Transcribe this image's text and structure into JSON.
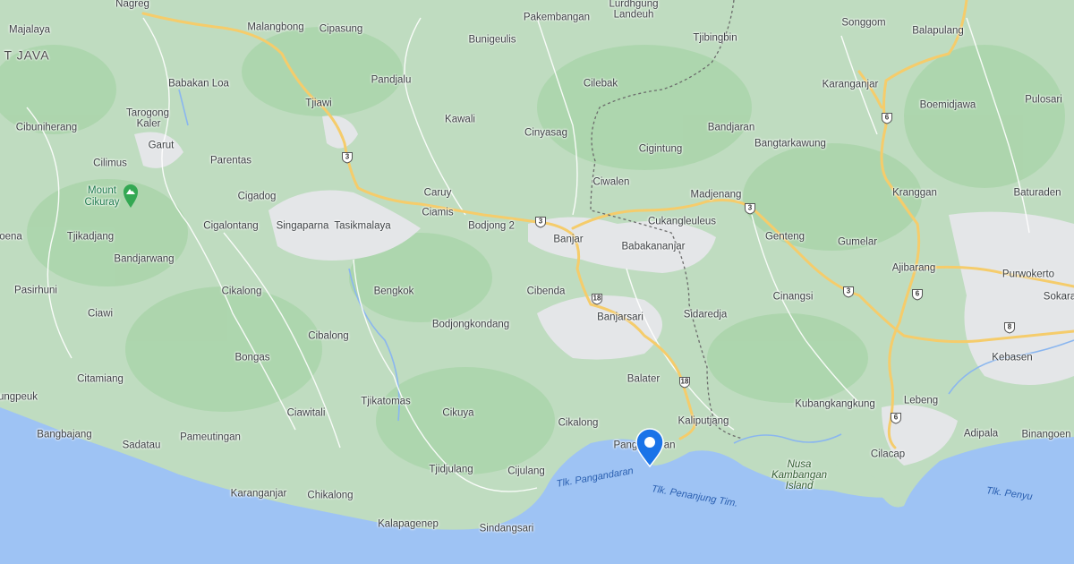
{
  "map": {
    "colors": {
      "land": "#bfdcc0",
      "forest": "#a8d5aa",
      "urban": "#e8eaed",
      "sea": "#9ec4f5",
      "road_major": "#f7d27b",
      "road_minor": "#ffffff",
      "border": "#6b6b6b"
    },
    "region_label": "T JAVA",
    "places": [
      {
        "id": "nagreg",
        "name": "Nagreg"
      },
      {
        "id": "majalaya",
        "name": "Majalaya"
      },
      {
        "id": "malangbong",
        "name": "Malangbong"
      },
      {
        "id": "cipasung",
        "name": "Cipasung"
      },
      {
        "id": "bunigeulis",
        "name": "Bunigeulis"
      },
      {
        "id": "pakembangan",
        "name": "Pakembangan"
      },
      {
        "id": "lurdhgung",
        "name": "Lurdhgung"
      },
      {
        "id": "landeuh",
        "name": "Landeuh"
      },
      {
        "id": "tjibingbin",
        "name": "Tjibingbin"
      },
      {
        "id": "songgom",
        "name": "Songgom"
      },
      {
        "id": "balapulang",
        "name": "Balapulang"
      },
      {
        "id": "babakan-loa",
        "name": "Babakan Loa"
      },
      {
        "id": "pandjalu",
        "name": "Pandjalu"
      },
      {
        "id": "cilebak",
        "name": "Cilebak"
      },
      {
        "id": "karanganjar-n",
        "name": "Karanganjar"
      },
      {
        "id": "boemidjawa",
        "name": "Boemidjawa"
      },
      {
        "id": "pulosari",
        "name": "Pulosari"
      },
      {
        "id": "tarogong",
        "name": "Tarogong"
      },
      {
        "id": "kaler",
        "name": "Kaler"
      },
      {
        "id": "tjiawi",
        "name": "Tjiawi"
      },
      {
        "id": "kawali",
        "name": "Kawali"
      },
      {
        "id": "cibuniherang",
        "name": "Cibuniherang"
      },
      {
        "id": "cinyasag",
        "name": "Cinyasag"
      },
      {
        "id": "bandjaran",
        "name": "Bandjaran"
      },
      {
        "id": "garut",
        "name": "Garut"
      },
      {
        "id": "bangtarkawung",
        "name": "Bangtarkawung"
      },
      {
        "id": "cigintung",
        "name": "Cigintung"
      },
      {
        "id": "parentas",
        "name": "Parentas"
      },
      {
        "id": "cilimus",
        "name": "Cilimus"
      },
      {
        "id": "ciwalen",
        "name": "Ciwalen"
      },
      {
        "id": "cigadog",
        "name": "Cigadog"
      },
      {
        "id": "caruy",
        "name": "Caruy"
      },
      {
        "id": "madjenang",
        "name": "Madjenang"
      },
      {
        "id": "kranggan",
        "name": "Kranggan"
      },
      {
        "id": "baturaden",
        "name": "Baturaden"
      },
      {
        "id": "ciamis",
        "name": "Ciamis"
      },
      {
        "id": "cukangleuleus",
        "name": "Cukangleuleus"
      },
      {
        "id": "cigalontang",
        "name": "Cigalontang"
      },
      {
        "id": "singaparna",
        "name": "Singaparna"
      },
      {
        "id": "tasikmalaya",
        "name": "Tasikmalaya"
      },
      {
        "id": "bodjong2",
        "name": "Bodjong 2"
      },
      {
        "id": "banjar",
        "name": "Banjar"
      },
      {
        "id": "genteng",
        "name": "Genteng"
      },
      {
        "id": "gumelar",
        "name": "Gumelar"
      },
      {
        "id": "oena",
        "name": "oena"
      },
      {
        "id": "tjikadjang",
        "name": "Tjikadjang"
      },
      {
        "id": "babakananjar",
        "name": "Babakananjar"
      },
      {
        "id": "bandjarwang",
        "name": "Bandjarwang"
      },
      {
        "id": "ajibarang",
        "name": "Ajibarang"
      },
      {
        "id": "purwokerto",
        "name": "Purwokerto"
      },
      {
        "id": "sokara",
        "name": "Sokara"
      },
      {
        "id": "pasirhuni",
        "name": "Pasirhuni"
      },
      {
        "id": "cikalong-n",
        "name": "Cikalong"
      },
      {
        "id": "bengkok",
        "name": "Bengkok"
      },
      {
        "id": "cibenda",
        "name": "Cibenda"
      },
      {
        "id": "cinangsi",
        "name": "Cinangsi"
      },
      {
        "id": "ciawi",
        "name": "Ciawi"
      },
      {
        "id": "banjarsari",
        "name": "Banjarsari"
      },
      {
        "id": "sidaredja",
        "name": "Sidaredja"
      },
      {
        "id": "bodjongkondang",
        "name": "Bodjongkondang"
      },
      {
        "id": "cibalong",
        "name": "Cibalong"
      },
      {
        "id": "kebasen",
        "name": "Kebasen"
      },
      {
        "id": "bongas",
        "name": "Bongas"
      },
      {
        "id": "citamiang",
        "name": "Citamiang"
      },
      {
        "id": "balater",
        "name": "Balater"
      },
      {
        "id": "ungpeuk",
        "name": "ungpeuk"
      },
      {
        "id": "tjikatomas",
        "name": "Tjikatomas"
      },
      {
        "id": "kubangkangkung",
        "name": "Kubangkangkung"
      },
      {
        "id": "lebeng",
        "name": "Lebeng"
      },
      {
        "id": "ciawitali",
        "name": "Ciawitali"
      },
      {
        "id": "cikuya",
        "name": "Cikuya"
      },
      {
        "id": "cikalong-s",
        "name": "Cikalong"
      },
      {
        "id": "kaliputjang",
        "name": "Kaliputjang"
      },
      {
        "id": "adipala",
        "name": "Adipala"
      },
      {
        "id": "bangbajang",
        "name": "Bangbajang"
      },
      {
        "id": "pameutingan",
        "name": "Pameutingan"
      },
      {
        "id": "binangoen",
        "name": "Binangoen"
      },
      {
        "id": "sadatau",
        "name": "Sadatau"
      },
      {
        "id": "pangandaran",
        "name": "Pangandaran"
      },
      {
        "id": "cilacap",
        "name": "Cilacap"
      },
      {
        "id": "tjidjulang",
        "name": "Tjidjulang"
      },
      {
        "id": "cijulang",
        "name": "Cijulang"
      },
      {
        "id": "karanganjar-s",
        "name": "Karanganjar"
      },
      {
        "id": "chikalong",
        "name": "Chikalong"
      },
      {
        "id": "kalapagenep",
        "name": "Kalapagenep"
      },
      {
        "id": "sindangsari",
        "name": "Sindangsari"
      }
    ],
    "poi": {
      "name_line1": "Mount",
      "name_line2": "Cikuray",
      "icon": "mountain-icon"
    },
    "island": {
      "line1": "Nusa",
      "line2": "Kambangan",
      "line3": "Island"
    },
    "water": [
      {
        "id": "tlk-pangandaran",
        "name": "Tlk. Pangandaran"
      },
      {
        "id": "tlk-penanjung",
        "name": "Tlk. Penanjung Tim."
      },
      {
        "id": "tlk-penyu",
        "name": "Tlk. Penyu"
      }
    ],
    "shields": [
      {
        "id": "r3a",
        "num": "3"
      },
      {
        "id": "r3b",
        "num": "3"
      },
      {
        "id": "r3c",
        "num": "3"
      },
      {
        "id": "r3d",
        "num": "3"
      },
      {
        "id": "r18a",
        "num": "18"
      },
      {
        "id": "r18b",
        "num": "18"
      },
      {
        "id": "r6a",
        "num": "6"
      },
      {
        "id": "r6b",
        "num": "6"
      },
      {
        "id": "r6c",
        "num": "6"
      },
      {
        "id": "r8",
        "num": "8"
      }
    ],
    "marker": {
      "icon": "location-pin-icon",
      "color": "#1a73e8"
    }
  }
}
